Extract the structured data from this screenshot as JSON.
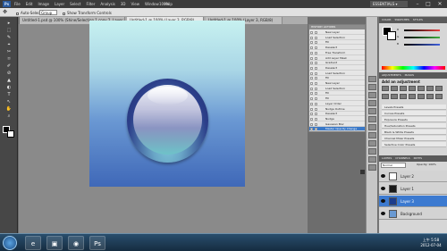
{
  "app": {
    "logo": "Ps",
    "menus": [
      "File",
      "Edit",
      "Image",
      "Layer",
      "Select",
      "Filter",
      "Analysis",
      "3D",
      "View",
      "Window",
      "Help"
    ],
    "zoom": "100%",
    "workspace": "ESSENTIALS ▾",
    "window_controls": [
      "–",
      "□",
      "✕"
    ]
  },
  "options": {
    "auto_select_label": "Auto-Select:",
    "auto_select_value": "Group",
    "transform_label": "Show Transform Controls"
  },
  "tabs": [
    {
      "label": "Untitled-1.psd @ 100% (Shine/Selection 1 copy 2, Layer Mask/8)"
    },
    {
      "label": "Untitled-1 @ 100% (Layer 3, RGB/8)"
    },
    {
      "label": "Untitled-1 @ 100% (Layer 3, RGB/8)"
    }
  ],
  "tools": [
    "▸",
    "⬚",
    "✎",
    "⌖",
    "✂",
    "⌑",
    "✐",
    "⊘",
    "▲",
    "◐",
    "T",
    "↖",
    "✋",
    "⌕"
  ],
  "actions": {
    "header": "HISTORY  ACTIONS",
    "rows": [
      "New Layer",
      "Load Selection",
      "Fill",
      "Deselect",
      "Free Transform",
      "Add Layer Mask",
      "Gradient",
      "Deselect",
      "Load Selection",
      "Fill",
      "New Layer",
      "Load Selection",
      "Fill",
      "Fill",
      "Layer Order",
      "Nudge Outline",
      "Deselect",
      "Nudge",
      "Gaussian Blur",
      "Master Opacity Change"
    ]
  },
  "panels": {
    "color_tabs": [
      "COLOR",
      "SWATCHES",
      "STYLES"
    ],
    "channels": [
      "R",
      "G",
      "B"
    ],
    "slider_colors": [
      "#e84040",
      "#3fae3f",
      "#3f5fdc"
    ],
    "adjust_tabs": [
      "ADJUSTMENTS",
      "MASKS"
    ],
    "adjust_title": "Add an adjustment",
    "presets": [
      "Levels Presets",
      "Curves Presets",
      "Exposure Presets",
      "Hue/Saturation Presets",
      "Black & White Presets",
      "Channel Mixer Presets",
      "Selective Color Presets"
    ],
    "layer_tabs": [
      "LAYERS",
      "CHANNELS",
      "PATHS"
    ],
    "blend": "Normal",
    "opacity": "Opacity: 100%",
    "layers": [
      {
        "name": "Layer 2",
        "selected": false,
        "thumb": "#ffffff"
      },
      {
        "name": "Layer 1",
        "selected": false,
        "thumb": "#1a1a1a"
      },
      {
        "name": "Layer 3",
        "selected": true,
        "thumb": "#1b3c8c"
      },
      {
        "name": "Background",
        "selected": false,
        "thumb": "#6a9ad3"
      }
    ]
  },
  "taskbar": {
    "apps": [
      "e",
      "▣",
      "◉",
      "Ps"
    ],
    "time": "上午 5:58",
    "date": "2012-07-04"
  }
}
